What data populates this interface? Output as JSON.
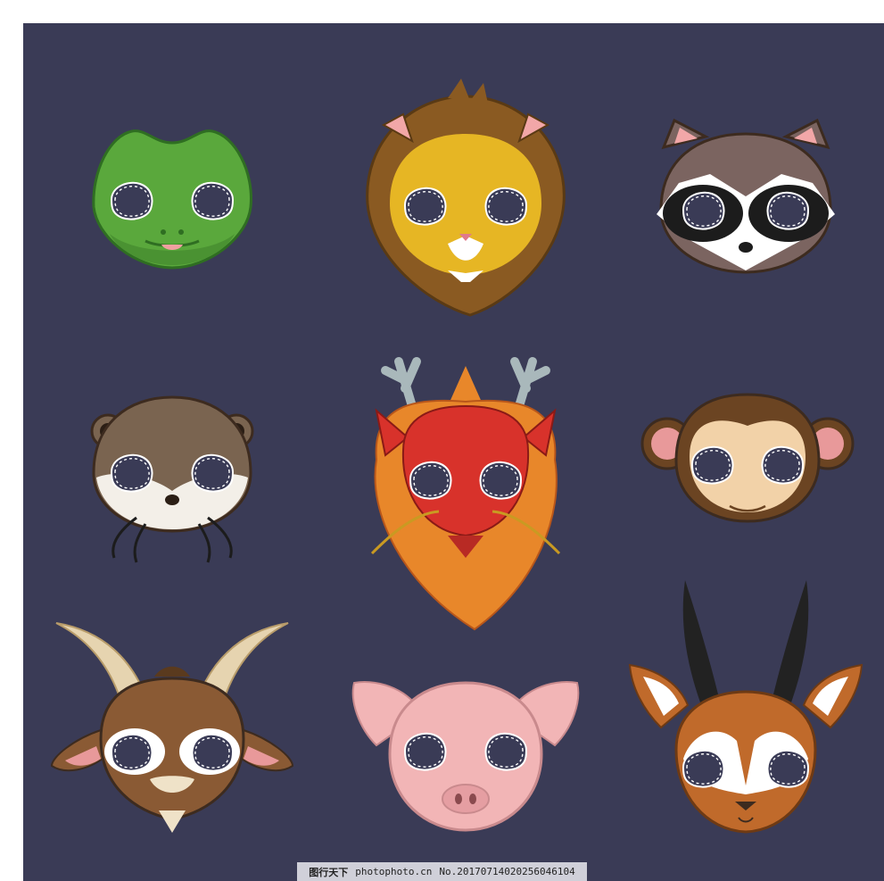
{
  "colors": {
    "background": "#3a3b56",
    "frame": "#ffffff",
    "eye_hole": "#3a3b56",
    "stitch": "#ffffff",
    "outline": "#3d2b1f"
  },
  "masks": [
    {
      "name": "crocodile",
      "colors": {
        "main": "#5aa83c",
        "dark": "#2f6e22"
      }
    },
    {
      "name": "lion",
      "colors": {
        "mane": "#8a5a22",
        "face": "#e6b624"
      }
    },
    {
      "name": "raccoon",
      "colors": {
        "main": "#7b6460",
        "patch": "#1c1c1c"
      }
    },
    {
      "name": "otter",
      "colors": {
        "main": "#7a6450",
        "muzzle": "#f3efe8"
      }
    },
    {
      "name": "dragon",
      "colors": {
        "main": "#d8322b",
        "mane": "#e8872a",
        "antler": "#a9b8bb"
      }
    },
    {
      "name": "monkey",
      "colors": {
        "main": "#6b4422",
        "face": "#f2d2a8",
        "ear": "#e8999a"
      }
    },
    {
      "name": "goat",
      "colors": {
        "main": "#8a5a34",
        "horn": "#e6d4b0"
      }
    },
    {
      "name": "pig",
      "colors": {
        "main": "#f2b5b6",
        "snout": "#e59ea2"
      }
    },
    {
      "name": "antelope",
      "colors": {
        "main": "#c06a2b",
        "horn": "#222222"
      }
    }
  ],
  "watermark": {
    "site": "图行天下",
    "url": "photophoto.cn",
    "id": "No.20170714020256046104"
  }
}
